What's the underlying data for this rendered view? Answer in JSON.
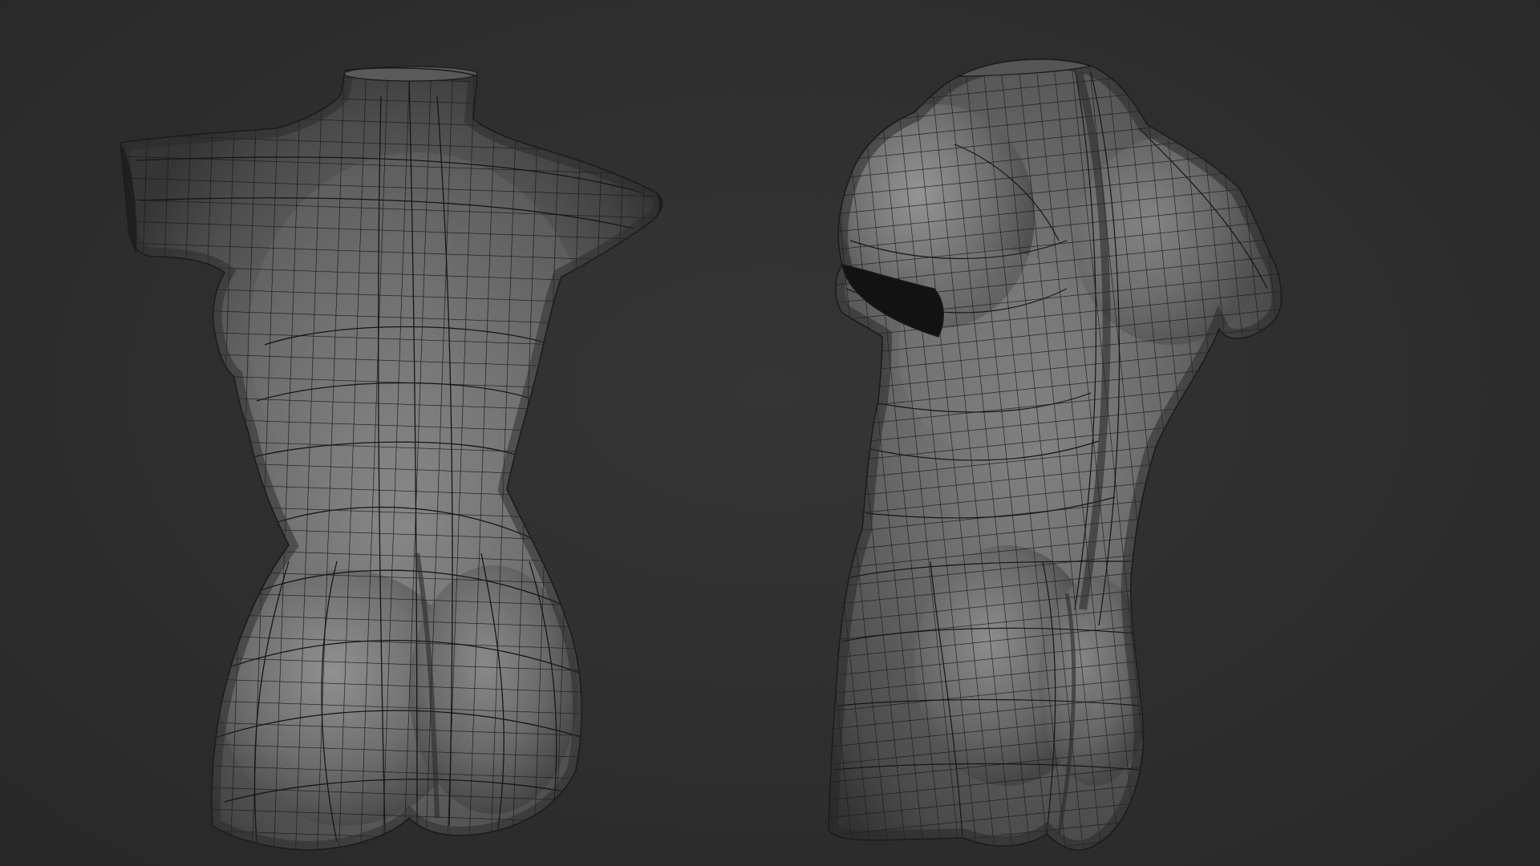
{
  "viewport": {
    "background_color": "#2e2e2e",
    "render_style": "wireframe-on-shaded"
  },
  "models": [
    {
      "label": "female-torso-back-view",
      "shade_color": "#6e6e6e",
      "wire_color": "#1a1a1a"
    },
    {
      "label": "male-torso-three-quarter-back-view",
      "shade_color": "#6e6e6e",
      "wire_color": "#1a1a1a"
    }
  ]
}
